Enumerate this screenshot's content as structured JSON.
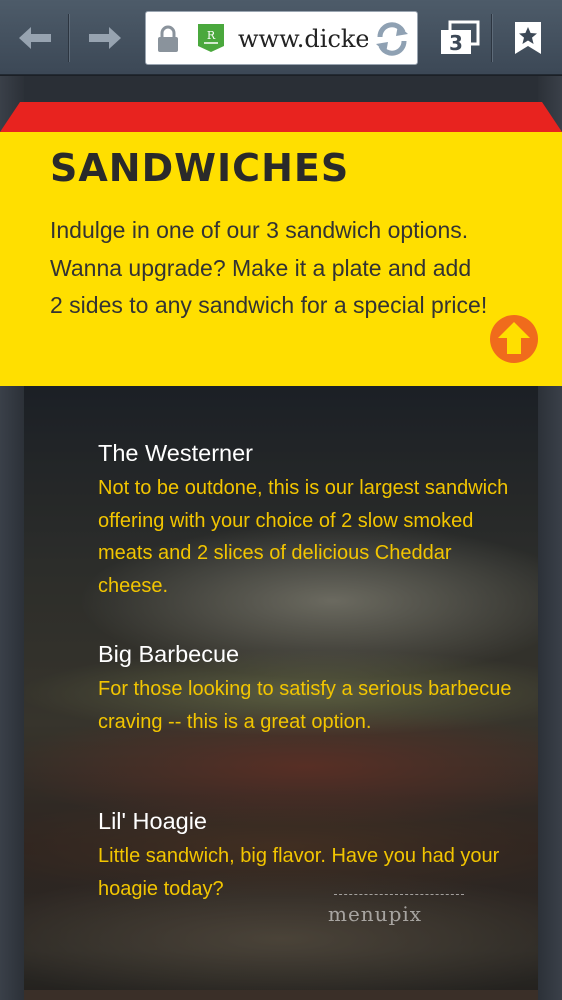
{
  "browser": {
    "url_text": "www.dicke",
    "tab_count": "3",
    "icons": [
      "back-arrow-icon",
      "forward-arrow-icon",
      "lock-icon",
      "r-badge-icon",
      "reload-icon",
      "tabs-icon",
      "bookmark-star-icon"
    ],
    "rbadge_letter": "R"
  },
  "banner": {
    "title": "SANDWICHES",
    "text": "Indulge in one of our 3 sandwich options. Wanna upgrade? Make it a plate and add 2 sides to any sandwich for a special price!",
    "accent_yellow": "#ffdf00",
    "accent_red": "#e8231f",
    "scroll_up_icon": "arrow-up-circle-icon"
  },
  "menu": {
    "items": [
      {
        "name": "The Westerner",
        "description": "Not to be outdone, this is our largest sandwich offering with your choice of 2 slow smoked meats and 2 slices of delicious Cheddar cheese."
      },
      {
        "name": "Big Barbecue",
        "description": "For those looking to satisfy a serious barbecue craving -- this is a great option."
      },
      {
        "name": "Lil' Hoagie",
        "description": "Little sandwich, big flavor. Have you had your hoagie today?"
      }
    ],
    "name_color": "#ffffff",
    "description_color": "#f2c500"
  },
  "watermark": "menupix"
}
